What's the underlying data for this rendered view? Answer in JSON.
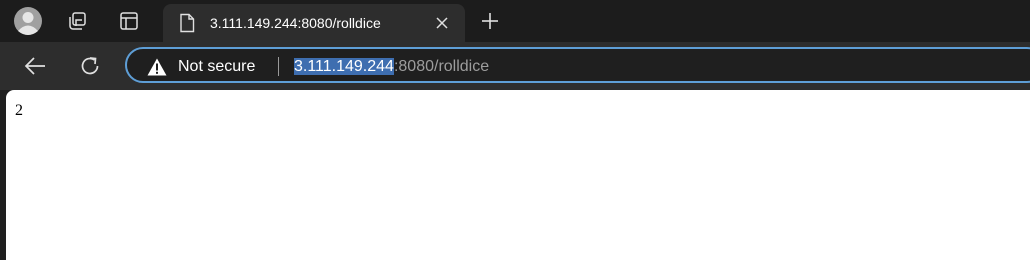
{
  "browser": {
    "tab": {
      "title": "3.111.149.244:8080/rolldice"
    },
    "omnibox": {
      "security_label": "Not secure",
      "url_host": "3.111.149.244",
      "url_rest": ":8080/rolldice"
    },
    "icons": [
      "profile-avatar-icon",
      "workspaces-icon",
      "tab-actions-icon",
      "page-favicon-icon",
      "close-icon",
      "plus-icon",
      "back-arrow-icon",
      "refresh-icon",
      "warning-icon"
    ],
    "colors": {
      "omnibox_border": "#5e9ed6",
      "selection": "#3e6eb0"
    }
  },
  "page": {
    "body_text": "2"
  }
}
